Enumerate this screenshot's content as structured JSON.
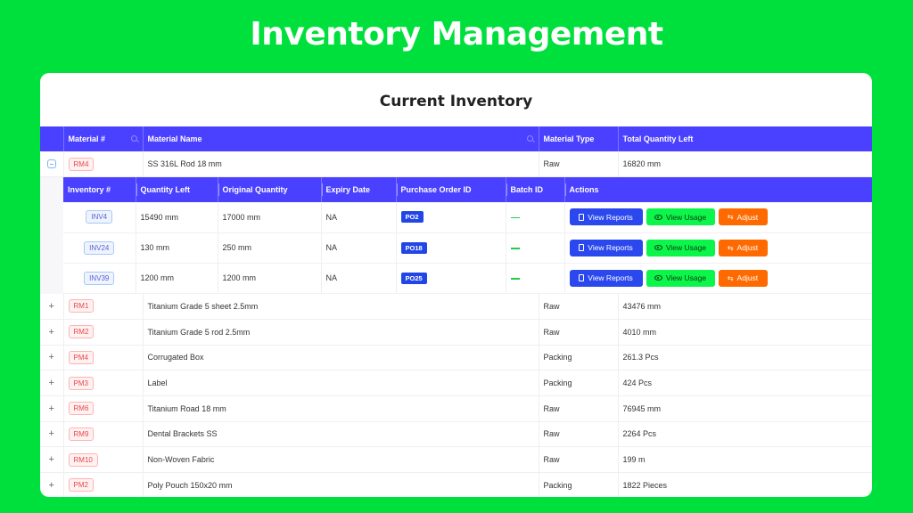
{
  "page": {
    "title": "Inventory Management"
  },
  "card": {
    "title": "Current Inventory"
  },
  "main_columns": [
    "Material #",
    "Material Name",
    "Material Type",
    "Total Quantity Left"
  ],
  "expanded_row": {
    "material_no": "RM4",
    "name": "SS 316L Rod 18 mm",
    "type": "Raw",
    "total": "16820 mm",
    "sub_columns": [
      "Inventory #",
      "Quantity Left",
      "Original Quantity",
      "Expiry Date",
      "Purchase Order ID",
      "Batch ID",
      "Actions"
    ],
    "sub_rows": [
      {
        "inventory_no": "INV4",
        "qty_left": "15490 mm",
        "original_qty": "17000 mm",
        "expiry": "NA",
        "po_id": "PO2"
      },
      {
        "inventory_no": "INV24",
        "qty_left": "130 mm",
        "original_qty": "250 mm",
        "expiry": "NA",
        "po_id": "PO18"
      },
      {
        "inventory_no": "INV39",
        "qty_left": "1200 mm",
        "original_qty": "1200 mm",
        "expiry": "NA",
        "po_id": "PO25"
      }
    ],
    "actions": {
      "view_reports": "View Reports",
      "view_usage": "View Usage",
      "adjust": "Adjust"
    }
  },
  "rows": [
    {
      "material_no": "RM1",
      "name": "Titanium Grade 5 sheet 2.5mm",
      "type": "Raw",
      "total": "43476 mm"
    },
    {
      "material_no": "RM2",
      "name": "Titanium Grade 5 rod 2.5mm",
      "type": "Raw",
      "total": "4010 mm"
    },
    {
      "material_no": "PM4",
      "name": "Corrugated Box",
      "type": "Packing",
      "total": "261.3 Pcs"
    },
    {
      "material_no": "PM3",
      "name": "Label",
      "type": "Packing",
      "total": "424 Pcs"
    },
    {
      "material_no": "RM6",
      "name": "Titanium Road 18 mm",
      "type": "Raw",
      "total": "76945 mm"
    },
    {
      "material_no": "RM9",
      "name": "Dental Brackets SS",
      "type": "Raw",
      "total": "2264 Pcs"
    },
    {
      "material_no": "RM10",
      "name": "Non-Woven Fabric",
      "type": "Raw",
      "total": "199 m"
    },
    {
      "material_no": "PM2",
      "name": "Poly Pouch 150x20 mm",
      "type": "Packing",
      "total": "1822 Pieces"
    }
  ],
  "colors": {
    "background": "#00e03c",
    "header": "#4a40ff",
    "view_reports": "#2a48ee",
    "view_usage": "#0bf54a",
    "adjust": "#ff6a00"
  }
}
